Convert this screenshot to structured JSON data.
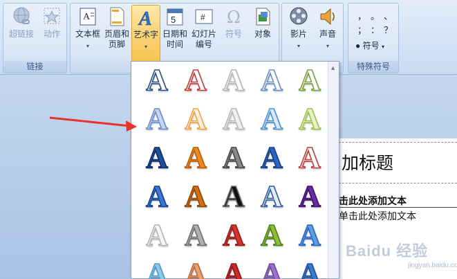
{
  "ribbon": {
    "groups": {
      "links": {
        "label": "链接",
        "hyperlink": "超链接",
        "action": "动作"
      },
      "text": {
        "textbox": "文本框",
        "header_footer": [
          "页眉和",
          "页脚"
        ],
        "wordart": "艺术字",
        "datetime": [
          "日期和",
          "时间"
        ],
        "slide_number": [
          "幻灯片",
          "编号"
        ],
        "symbol": "符号",
        "object": "对象"
      },
      "media": {
        "movie": "影片",
        "sound": "声音"
      },
      "special": {
        "label": "特殊符号",
        "symbols": [
          "，",
          "。",
          "、",
          "；",
          "：",
          "？"
        ],
        "symbol_button": "符号"
      }
    }
  },
  "wordart_gallery": {
    "rows": [
      [
        "A",
        "A",
        "A",
        "A",
        "A"
      ],
      [
        "A",
        "A",
        "A",
        "A",
        "A"
      ],
      [
        "A",
        "A",
        "A",
        "A",
        "A"
      ],
      [
        "A",
        "A",
        "A",
        "A",
        "A"
      ],
      [
        "A",
        "A",
        "A",
        "A",
        "A"
      ],
      [
        "A",
        "A",
        "A",
        "A",
        "A"
      ]
    ],
    "colors": [
      [
        "#ffffff",
        "#ffffff",
        "#ffffff",
        "#ffffff",
        "#ffffff"
      ],
      [
        "#c6d6f2",
        "#fff2dc",
        "#f0f0f0",
        "#d8e9fb",
        "#e7f2c8"
      ],
      [
        "#1f4f9a",
        "#ee8a20",
        "#8a8a8a",
        "#2a64c6",
        "#ffffff"
      ],
      [
        "#3a78d0",
        "#d56d12",
        "#111111",
        "#e4ecf6",
        "#6a2aa8"
      ],
      [
        "#f6f6f6",
        "#b0b0b0",
        "#d8332c",
        "#8bbf38",
        "#5aa0e0"
      ],
      [
        "#8ec9e8",
        "#e9a070",
        "#cc2a2a",
        "#9a72c8",
        "#3a7cc8"
      ]
    ],
    "strokes": [
      [
        "#2a4d86",
        "#c23a3a",
        "#b5b5b5",
        "#6a8fc0",
        "#7aa03a"
      ],
      [
        "#6c8dc8",
        "#f0a24a",
        "#b8b8b8",
        "#4d8fd6",
        "#9ec24e"
      ],
      [
        "#0d2f66",
        "#b35e0c",
        "#444444",
        "#163f7e",
        "#c23a3a"
      ],
      [
        "#17408a",
        "#8c4508",
        "#6f6f6f",
        "#2c5aa0",
        "#3c1166"
      ],
      [
        "#b5b5b5",
        "#6f6f6f",
        "#8c1e1e",
        "#4e7e1a",
        "#2a64c6"
      ],
      [
        "#4e9ac8",
        "#b86a3a",
        "#881818",
        "#6d4aa0",
        "#1f4f9a"
      ]
    ]
  },
  "slide": {
    "title_text": "加标题",
    "body_line1": "击此处添加文本",
    "body_line2": "单击此处添加文本",
    "watermark": "Baidu 经验",
    "watermark_sub": "jingyan.baidu.com"
  },
  "theme": {
    "accent_arrow": "#e8332c",
    "active_button": "#fbd27a"
  }
}
